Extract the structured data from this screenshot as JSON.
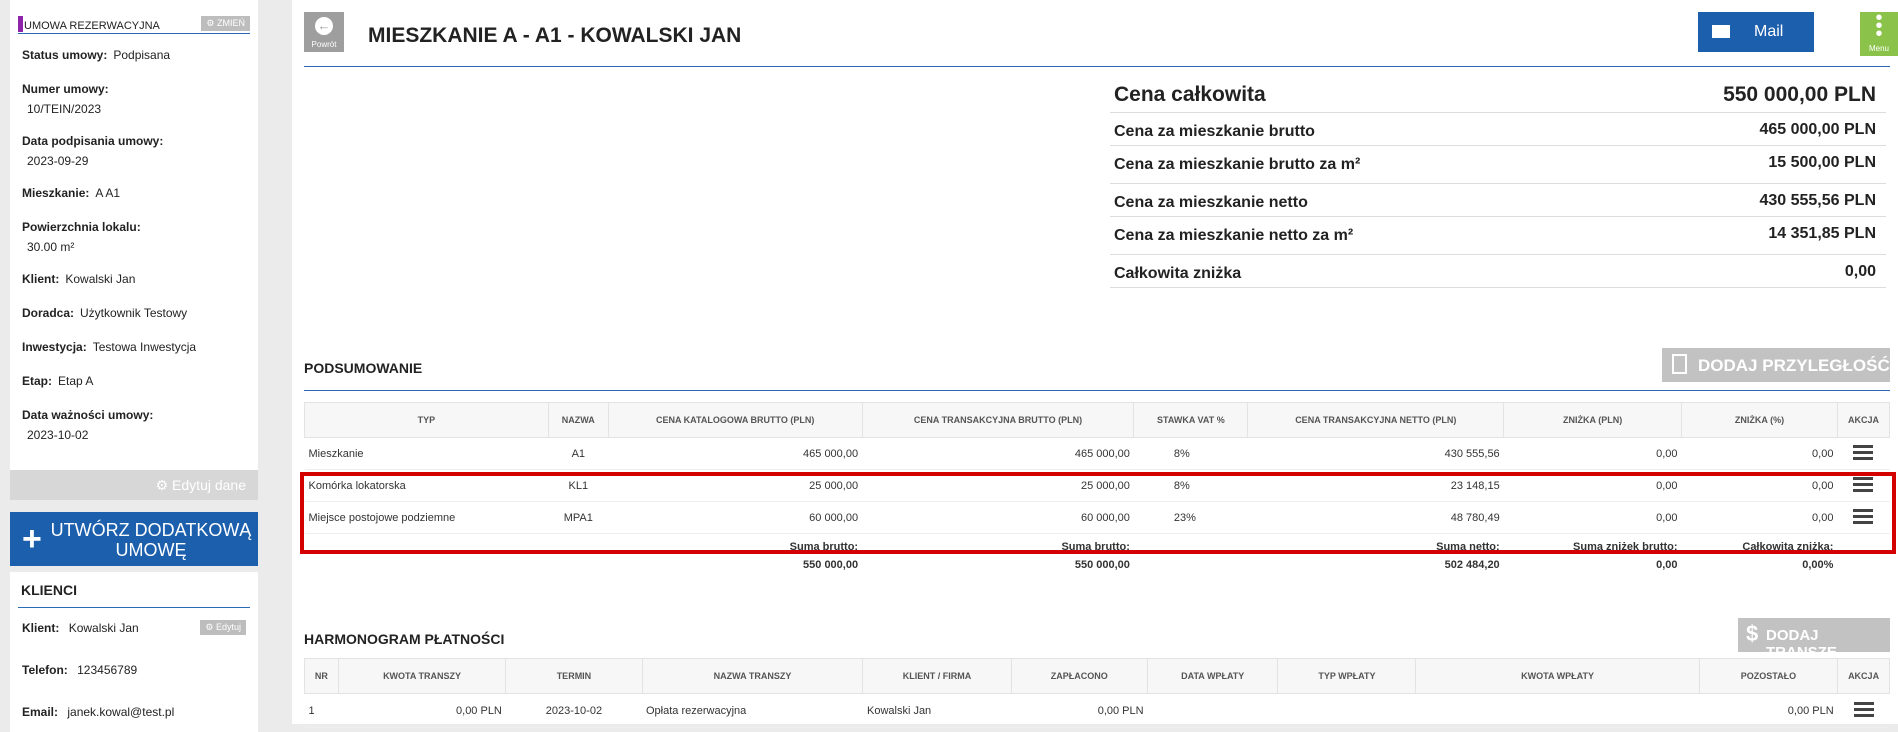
{
  "contract": {
    "section_title": "UMOWA REZERWACYJNA",
    "change_label": "⚙ ZMIEŃ",
    "fields": [
      {
        "label": "Status umowy:",
        "value": "Podpisana",
        "layout": "inline"
      },
      {
        "label": "Numer umowy:",
        "value": "10/TEIN/2023",
        "layout": "stack"
      },
      {
        "label": "Data podpisania umowy:",
        "value": "2023-09-29",
        "layout": "stack"
      },
      {
        "label": "Mieszkanie:",
        "value": "A A1",
        "layout": "inline"
      },
      {
        "label": "Powierzchnia lokalu:",
        "value": "30.00 m²",
        "layout": "stack"
      },
      {
        "label": "Klient:",
        "value": "Kowalski Jan",
        "layout": "inline"
      },
      {
        "label": "Doradca:",
        "value": "Użytkownik Testowy",
        "layout": "inline"
      },
      {
        "label": "Inwestycja:",
        "value": "Testowa Inwestycja",
        "layout": "inline"
      },
      {
        "label": "Etap:",
        "value": "Etap A",
        "layout": "inline"
      },
      {
        "label": "Data ważności umowy:",
        "value": "2023-10-02",
        "layout": "stack"
      }
    ],
    "edit_label": "⚙ Edytuj dane"
  },
  "create_button": {
    "icon": "plus-icon",
    "label": "UTWÓRZ DODATKOWĄ UMOWĘ"
  },
  "clients": {
    "section_title": "KLIENCI",
    "client_label": "Klient:",
    "client_value": "Kowalski Jan",
    "edit_label": "⚙ Edytuj",
    "phone_label": "Telefon:",
    "phone_value": "123456789",
    "email_label": "Email:",
    "email_value": "janek.kowal@test.pl"
  },
  "header": {
    "back_label": "Powrót",
    "title": "MIESZKANIE A - A1 - KOWALSKI JAN",
    "mail_label": "Mail",
    "menu_label": "Menu"
  },
  "prices": [
    {
      "label": "Cena całkowita",
      "value": "550 000,00 PLN"
    },
    {
      "label": "Cena za mieszkanie brutto",
      "value": "465 000,00 PLN"
    },
    {
      "label": "Cena za mieszkanie brutto za m²",
      "value": "15 500,00 PLN"
    },
    {
      "label": "Cena za mieszkanie netto",
      "value": "430 555,56 PLN"
    },
    {
      "label": "Cena za mieszkanie netto za m²",
      "value": "14 351,85 PLN"
    },
    {
      "label": "Całkowita zniżka",
      "value": "0,00"
    }
  ],
  "summary": {
    "title": "PODSUMOWANIE",
    "add_button": "DODAJ PRZYLEGŁOŚĆ",
    "headers": [
      "TYP",
      "NAZWA",
      "CENA KATALOGOWA BRUTTO (PLN)",
      "CENA TRANSAKCYJNA BRUTTO (PLN)",
      "STAWKA VAT %",
      "CENA TRANSAKCYJNA NETTO (PLN)",
      "ZNIŻKA (PLN)",
      "ZNIŻKA (%)",
      "AKCJA"
    ],
    "rows": [
      [
        "Mieszkanie",
        "A1",
        "465 000,00",
        "465 000,00",
        "8%",
        "430 555,56",
        "0,00",
        "0,00"
      ],
      [
        "Komórka lokatorska",
        "KL1",
        "25 000,00",
        "25 000,00",
        "8%",
        "23 148,15",
        "0,00",
        "0,00"
      ],
      [
        "Miejsce postojowe podziemne",
        "MPA1",
        "60 000,00",
        "60 000,00",
        "23%",
        "48 780,49",
        "0,00",
        "0,00"
      ]
    ],
    "totals": {
      "catalog_label": "Suma brutto:",
      "catalog_value": "550 000,00",
      "trans_label": "Suma brutto:",
      "trans_value": "550 000,00",
      "net_label": "Suma netto:",
      "net_value": "502 484,20",
      "disc_label": "Suma zniżek brutto:",
      "disc_value": "0,00",
      "pct_label": "Całkowita zniżka:",
      "pct_value": "0,00%"
    }
  },
  "payments": {
    "title": "HARMONOGRAM PŁATNOŚCI",
    "add_button": "DODAJ TRANSZĘ",
    "headers": [
      "NR",
      "KWOTA TRANSZY",
      "TERMIN",
      "NAZWA TRANSZY",
      "KLIENT / FIRMA",
      "ZAPŁACONO",
      "DATA WPŁATY",
      "TYP WPŁATY",
      "KWOTA WPŁATY",
      "POZOSTAŁO",
      "AKCJA"
    ],
    "rows": [
      [
        "1",
        "0,00 PLN",
        "2023-10-02",
        "Opłata rezerwacyjna",
        "Kowalski Jan",
        "0,00 PLN",
        "",
        "",
        "",
        "0,00 PLN"
      ]
    ]
  }
}
